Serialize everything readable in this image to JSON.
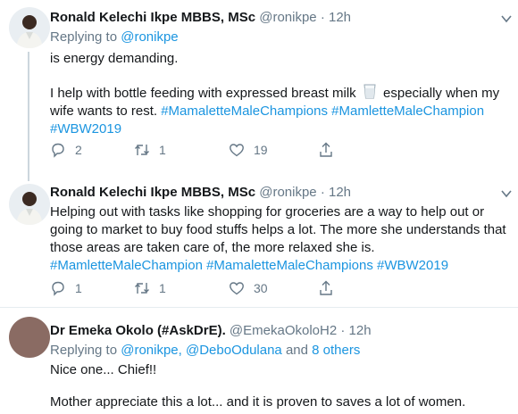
{
  "tweets": [
    {
      "author": "Ronald Kelechi Ikpe MBBS, MSc",
      "handle": "@ronikpe",
      "dot": "·",
      "time": "12h",
      "replying_prefix": "Replying to",
      "replying_to": "@ronikpe",
      "lines": [
        "is energy demanding.",
        "I help with bottle feeding with expressed breast milk",
        "especially when my",
        "wife wants to rest.",
        "#MamaletteMaleChampions #MamletteMaleChampion",
        "#WBW2019"
      ],
      "reply_count": "2",
      "retweet_count": "1",
      "like_count": "19",
      "glass_emoji": "milk-glass-icon"
    },
    {
      "author": "Ronald Kelechi Ikpe MBBS, MSc",
      "handle": "@ronikpe",
      "dot": "·",
      "time": "12h",
      "lines": [
        "Helping out with tasks like shopping for groceries are a way to help out or",
        "going to market to buy food stuffs helps a lot. The more she understands that",
        "those areas are taken care of, the more relaxed she is.",
        "#MamletteMaleChampion #MamaletteMaleChampions #WBW2019"
      ],
      "reply_count": "1",
      "retweet_count": "1",
      "like_count": "30"
    },
    {
      "author": "Dr Emeka Okolo (#AskDrE).",
      "handle": "@EmekaOkoloH2",
      "dot": "·",
      "time": "12h",
      "replying_prefix": "Replying to",
      "replying_to": "@ronikpe, @DeboOdulana",
      "replying_and": "and",
      "replying_others": "8 others",
      "lines": [
        "Nice one... Chief!!",
        "Mother appreciate this a lot... and it is proven to saves a lot of women."
      ]
    }
  ],
  "colors": {
    "link": "#1b95e0",
    "meta": "#657786",
    "divider": "#e6ecf0"
  }
}
